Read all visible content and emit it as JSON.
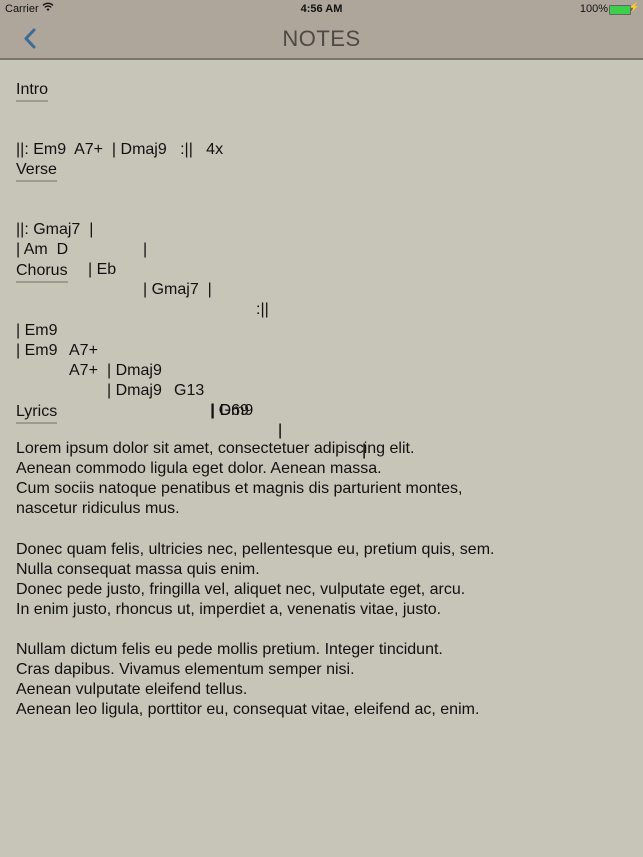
{
  "status_bar": {
    "carrier": "Carrier",
    "time": "4:56 AM",
    "battery_percent": "100%",
    "battery_level": 1.0,
    "battery_color": "#3cd04a"
  },
  "nav": {
    "title": "NOTES",
    "back_icon": "chevron-left-icon",
    "accent": "#3d6b96"
  },
  "sections": {
    "intro": {
      "heading": "Intro",
      "lines": [
        [
          "||: Em9  A7+  | Dmaj9   :||   4x"
        ]
      ]
    },
    "verse": {
      "heading": "Verse",
      "lines": [
        [
          "||: Gmaj7  |",
          "|"
        ],
        [
          "| Am  D",
          "| Eb",
          "| Gmaj7  |",
          ":||"
        ]
      ]
    },
    "chorus": {
      "heading": "Chorus",
      "lines": [
        [
          "| Em9",
          "A7+",
          "| Dmaj9",
          "G13",
          "| D69",
          "|",
          "|"
        ],
        [
          "| Em9",
          "A7+",
          "| Dmaj9",
          "| Gm9",
          "|",
          "|"
        ]
      ]
    },
    "lyrics": {
      "heading": "Lyrics",
      "lines": [
        "Lorem ipsum dolor sit amet, consectetuer adipiscing elit.",
        "Aenean commodo ligula eget dolor. Aenean massa.",
        "Cum sociis natoque penatibus et magnis dis parturient montes,",
        "nascetur ridiculus mus.",
        "",
        "Donec quam felis, ultricies nec, pellentesque eu, pretium quis, sem.",
        "Nulla consequat massa quis enim.",
        "Donec pede justo, fringilla vel, aliquet nec, vulputate eget, arcu.",
        "In enim justo, rhoncus ut, imperdiet a, venenatis vitae, justo.",
        "",
        "Nullam dictum felis eu pede mollis pretium. Integer tincidunt.",
        "Cras dapibus. Vivamus elementum semper nisi.",
        "Aenean vulputate eleifend tellus.",
        "Aenean leo ligula, porttitor eu, consequat vitae, eleifend ac, enim."
      ]
    }
  }
}
